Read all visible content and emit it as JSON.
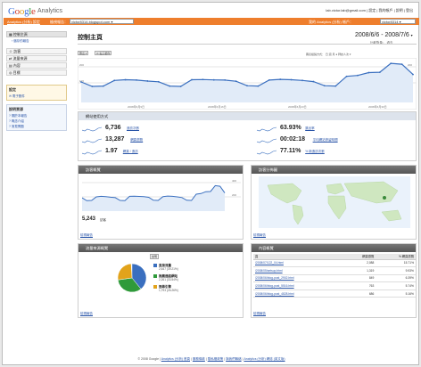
{
  "header": {
    "logo_google": "Google",
    "logo_product": "Analytics",
    "account_info": "lab.victor.lab@gmail.com | 設定 | 我的帳戶 | 說明 | 登出",
    "settings_label": "Analytics (分析) 設定",
    "view_report_label": "檢視報告：",
    "profile_value": "victor8314.blogspot.com",
    "my_account_label": "我的 Analytics (分析) 帳戶：",
    "account_value": "victor8314"
  },
  "sidebar": {
    "dashboard": "控制主頁",
    "saved_reports": "› 儲存的報告",
    "items": [
      {
        "label": "訪客",
        "icon": "visitors-icon"
      },
      {
        "label": "流量來源",
        "icon": "traffic-icon"
      },
      {
        "label": "內容",
        "icon": "content-icon"
      },
      {
        "label": "目標",
        "icon": "goals-icon"
      }
    ],
    "settings_title": "設定",
    "email_label": "電子郵件",
    "help_title": "說明資源",
    "help_items": [
      "關於本報告",
      "概念介紹",
      "常見問題"
    ]
  },
  "main": {
    "title": "控制主頁",
    "date_range": "2008/6/6 - 2008/7/6",
    "date_compare": "比較對象：  過去",
    "export_label": "匯出 ▾",
    "email_btn_label": "✉ 電子郵件",
    "graph_options": "圖表繪製方式：  日  週  月  ●  拜訪人次 ▾",
    "x_ticks": [
      "2008年6月9日",
      "2008年6月16日",
      "2008年6月23日",
      "2008年6月30日"
    ],
    "y_tick_top": "200",
    "y_tick_mid": "100",
    "y_tick_top_right": "200",
    "y_tick_mid_right": "100"
  },
  "chart_data": {
    "type": "line",
    "x": [
      "6/6",
      "6/7",
      "6/8",
      "6/9",
      "6/10",
      "6/11",
      "6/12",
      "6/13",
      "6/14",
      "6/15",
      "6/16",
      "6/17",
      "6/18",
      "6/19",
      "6/20",
      "6/21",
      "6/22",
      "6/23",
      "6/24",
      "6/25",
      "6/26",
      "6/27",
      "6/28",
      "6/29",
      "6/30",
      "7/1",
      "7/2",
      "7/3",
      "7/4",
      "7/5",
      "7/6"
    ],
    "series": [
      {
        "values": [
          110,
          86,
          88,
          118,
          122,
          120,
          115,
          111,
          88,
          86,
          122,
          123,
          121,
          120,
          114,
          90,
          88,
          120,
          124,
          122,
          118,
          112,
          90,
          88,
          140,
          145,
          160,
          162,
          210,
          205,
          150
        ]
      }
    ],
    "ylim": [
      0,
      220
    ],
    "color": "#3a6fbf"
  },
  "site_usage": {
    "title": "網站使用方式",
    "stats": [
      {
        "value": "6,736",
        "label": "造訪次數"
      },
      {
        "value": "13,287",
        "label": "網頁瀏覽"
      },
      {
        "value": "1.97",
        "label": "網頁 / 造訪"
      },
      {
        "value": "63.93%",
        "label": "跳出率"
      },
      {
        "value": "00:02:18",
        "label": "平均網站停留時間"
      },
      {
        "value": "77.11%",
        "label": "% 新造訪次數"
      }
    ]
  },
  "visitors_overview": {
    "title": "訪客概覽",
    "visitors_value": "5,243",
    "visitors_label": "訪客",
    "y_top": "400",
    "y_mid": "200",
    "footer": "檢視報告"
  },
  "map_overlay": {
    "title": "訪客分佈圖",
    "footer": "檢視報告"
  },
  "traffic_sources": {
    "title": "流量來源概覽",
    "button": "說明",
    "items": [
      {
        "label": "直接流量",
        "value": "2,647 (39.21%)",
        "color": "#3a6fbf"
      },
      {
        "label": "推薦連結網站",
        "value": "2,261 (33.54%)",
        "color": "#2f9a3a"
      },
      {
        "label": "搜尋引擎",
        "value": "1,793 (26.26%)",
        "color": "#e2a31b"
      }
    ],
    "footer": "檢視報告"
  },
  "content_overview": {
    "title": "內容概覽",
    "headers": [
      "頁",
      "網頁瀏覽",
      "% 網頁瀏覽"
    ],
    "rows": [
      [
        "/2008/07/122_04.html",
        "2,088",
        "15.71%"
      ],
      [
        "/2008/05/setsup.html",
        "1,319",
        "9.93%"
      ],
      [
        "/2008/06/blog-post_2902.html",
        "849",
        "6.39%"
      ],
      [
        "/2008/06/blog-post_5516.html",
        "763",
        "5.74%"
      ],
      [
        "/2008/06/blog-post_4828.html",
        "686",
        "5.16%"
      ]
    ],
    "footer": "檢視報告"
  },
  "footer": {
    "copyright": "© 2008 Google",
    "links": [
      "Analytics (分析) 首頁",
      "服務條款",
      "隱私權政策",
      "與我們聯絡",
      "Analytics (分析) 網誌 (英文版)"
    ]
  }
}
